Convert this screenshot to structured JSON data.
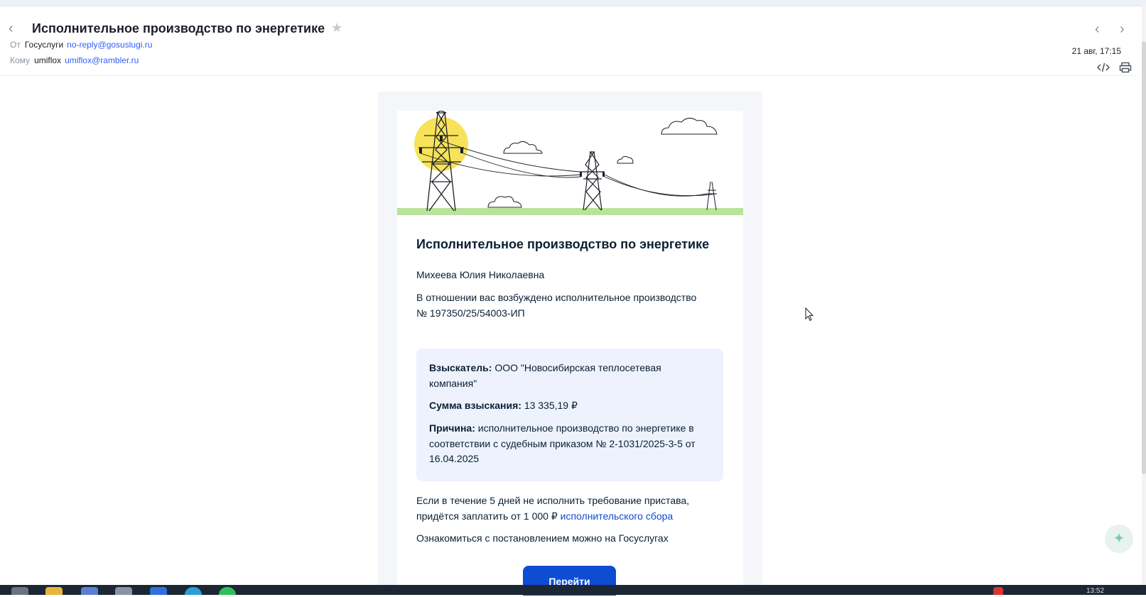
{
  "header": {
    "subject": "Исполнительное производство по энергетике",
    "from_label": "От",
    "from_name": "Госуслуги",
    "from_email": "no-reply@gosuslugi.ru",
    "to_label": "Кому",
    "to_name": "umiflox",
    "to_email": "umiflox@rambler.ru",
    "date": "21 авг, 17:15"
  },
  "email": {
    "title": "Исполнительное производство по энергетике",
    "recipient_name": "Михеева Юлия Николаевна",
    "intro_line1": "В отношении вас возбуждено исполнительное производство",
    "intro_line2": "№ 197350/25/54003-ИП",
    "details": {
      "claimant_label": "Взыскатель:",
      "claimant_value": "ООО \"Новосибирская теплосетевая компания\"",
      "amount_label": "Сумма взыскания:",
      "amount_value": "13 335,19 ₽",
      "reason_label": "Причина:",
      "reason_value": "исполнительное производство по энергетике в соответствии с судебным приказом № 2-1031/2025-3-5 от 16.04.2025"
    },
    "warning_text": "Если в течение 5 дней не исполнить требование пристава, придётся заплатить от 1 000 ₽",
    "warning_link": "исполнительского сбора",
    "info_text": "Ознакомиться с постановлением можно на Госуслугах",
    "button_label": "Перейти"
  },
  "taskbar": {
    "clock": "13:52"
  },
  "colors": {
    "accent": "#0d4cd3",
    "info_bg": "#edf2fd",
    "sun": "#f7e25a",
    "grass": "#b9e39b"
  }
}
